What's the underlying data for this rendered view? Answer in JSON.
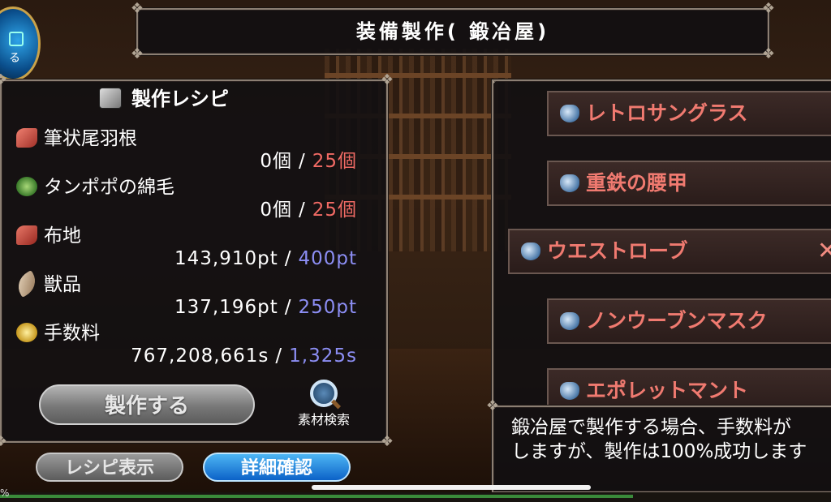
{
  "title": "装備製作( 鍛冶屋)",
  "menu_orb": {
    "label": "る"
  },
  "recipe": {
    "heading": "製作レシピ",
    "items": [
      {
        "name": "筆状尾羽根",
        "icon": "feather-icon",
        "have": "0個",
        "need": "25個",
        "need_color": "#f06a64"
      },
      {
        "name": "タンポポの綿毛",
        "icon": "dandelion-icon",
        "have": "0個",
        "need": "25個",
        "need_color": "#f06a64"
      },
      {
        "name": "布地",
        "icon": "cloth-icon",
        "have": "143,910pt",
        "need": "400pt",
        "need_color": "#8c8ef4"
      },
      {
        "name": "獣品",
        "icon": "horn-icon",
        "have": "137,196pt",
        "need": "250pt",
        "need_color": "#8c8ef4"
      },
      {
        "name": "手数料",
        "icon": "coins-icon",
        "have": "767,208,661s",
        "need": "1,325s",
        "need_color": "#8c8ef4"
      }
    ],
    "separator": "/",
    "craft_button": "製作する",
    "search_label": "素材検索"
  },
  "buttons": {
    "recipe_view": "レシピ表示",
    "details": "詳細確認"
  },
  "list": {
    "items": [
      {
        "label": "レトロサングラス",
        "selected": false
      },
      {
        "label": "重鉄の腰甲",
        "selected": false
      },
      {
        "label": "ウエストローブ",
        "selected": true,
        "close": "✕"
      },
      {
        "label": "ノンウーブンマスク",
        "selected": false
      },
      {
        "label": "エポレットマント",
        "selected": false
      }
    ]
  },
  "message": {
    "line1": "鍛冶屋で製作する場合、手数料が",
    "line2": "しますが、製作は100%成功します"
  },
  "status": {
    "percent_text": "%"
  },
  "colors": {
    "accent_red": "#f06a64",
    "accent_blue": "#8c8ef4",
    "list_text": "#f07a70",
    "frame": "#8c7f73"
  }
}
